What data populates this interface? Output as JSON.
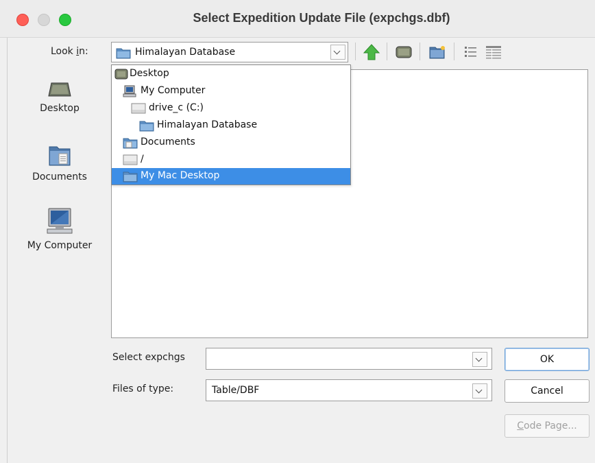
{
  "window": {
    "title": "Select Expedition Update File (expchgs.dbf)"
  },
  "lookin": {
    "label_prefix": "Look ",
    "label_mnemonic": "i",
    "label_suffix": "n:",
    "value": "Himalayan Database",
    "icon": "folder-icon"
  },
  "toolbar": {
    "icons": [
      "up-one-level-icon",
      "desktop-icon",
      "new-folder-icon",
      "list-view-icon",
      "details-view-icon"
    ]
  },
  "places": [
    {
      "label": "Desktop",
      "icon": "desktop-icon"
    },
    {
      "label": "Documents",
      "icon": "documents-folder-icon"
    },
    {
      "label": "My Computer",
      "icon": "computer-icon"
    }
  ],
  "dropdown": {
    "items": [
      {
        "label": "Desktop",
        "icon": "desktop-icon",
        "selected": false
      },
      {
        "label": "My Computer",
        "icon": "computer-icon",
        "selected": false
      },
      {
        "label": "drive_c (C:)",
        "icon": "drive-icon",
        "selected": false
      },
      {
        "label": "Himalayan Database",
        "icon": "folder-icon",
        "selected": false
      },
      {
        "label": "Documents",
        "icon": "documents-folder-icon",
        "selected": false
      },
      {
        "label": "/",
        "icon": "drive-icon",
        "selected": false
      },
      {
        "label": "My Mac Desktop",
        "icon": "folder-icon",
        "selected": true
      }
    ]
  },
  "file_name": {
    "label": "Select expchgs",
    "value": ""
  },
  "file_type": {
    "label": "Files of type:",
    "value": "Table/DBF"
  },
  "buttons": {
    "ok": "OK",
    "cancel": "Cancel",
    "code_page_mnemonic": "C",
    "code_page_rest": "ode Page..."
  },
  "colors": {
    "selection": "#3d8ee6",
    "traffic_close": "#fe5f57",
    "traffic_max": "#29c840",
    "up_arrow": "#3aa637"
  }
}
